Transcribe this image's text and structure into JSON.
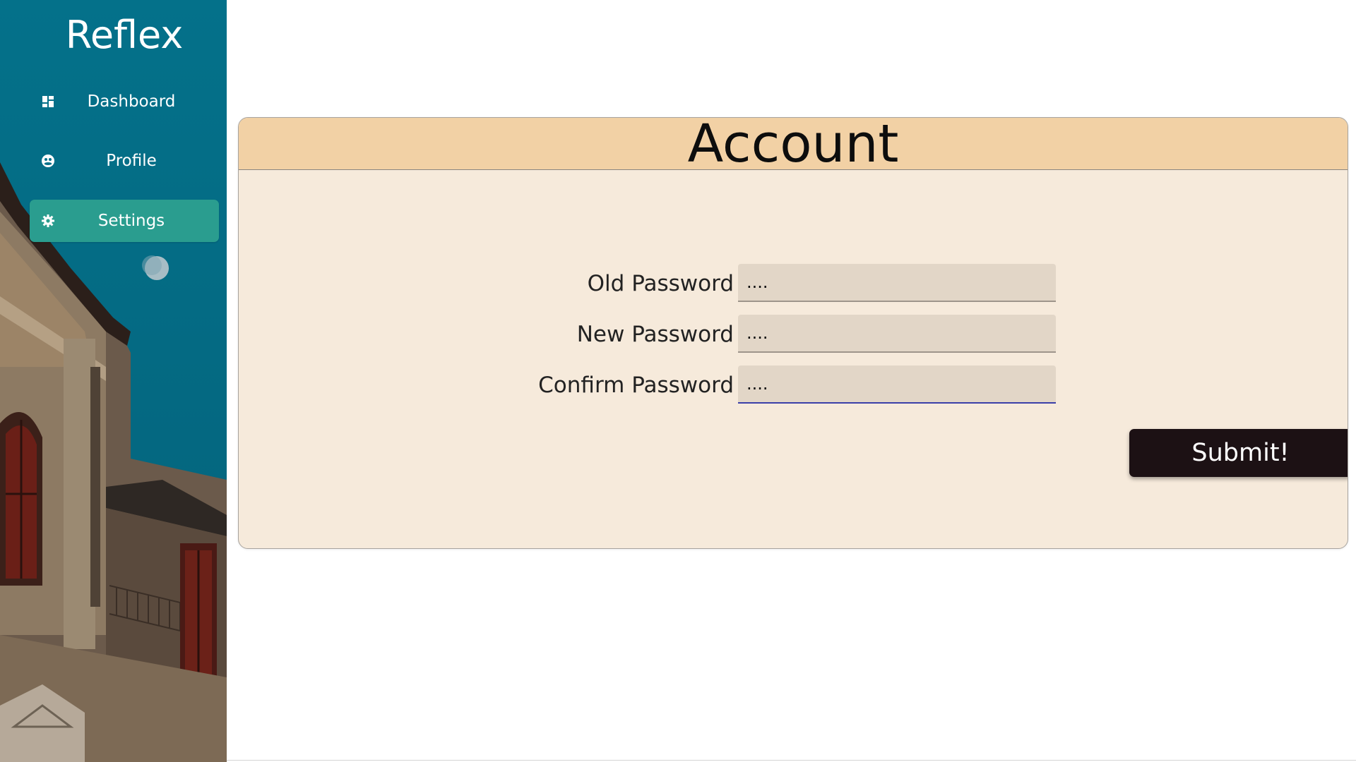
{
  "sidebar": {
    "brand": "Reflex",
    "items": [
      {
        "label": "Dashboard",
        "icon": "dashboard-icon",
        "active": false
      },
      {
        "label": "Profile",
        "icon": "profile-icon",
        "active": false
      },
      {
        "label": "Settings",
        "icon": "gear-icon",
        "active": true
      }
    ],
    "colors": {
      "sky": "#04718a",
      "active_item": "#2a9d8f"
    }
  },
  "main": {
    "card": {
      "title": "Account",
      "header_color": "#f2d1a5",
      "body_color": "#f6eadb",
      "fields": [
        {
          "label": "Old Password",
          "value": "....",
          "focused": false
        },
        {
          "label": "New Password",
          "value": "....",
          "focused": false
        },
        {
          "label": "Confirm Password",
          "value": "....",
          "focused": true
        }
      ],
      "submit_label": "Submit!"
    }
  }
}
